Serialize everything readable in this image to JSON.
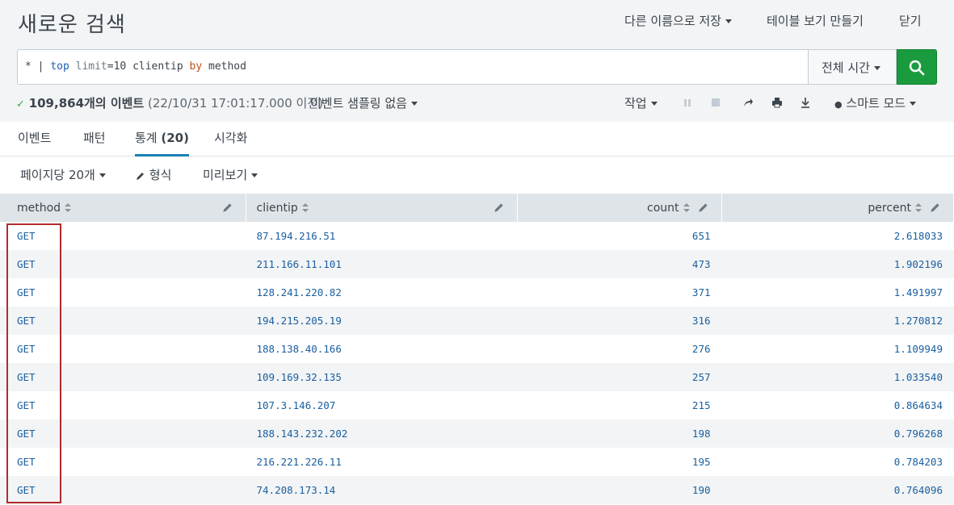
{
  "header": {
    "title": "새로운 검색",
    "save_as": "다른 이름으로 저장",
    "make_table": "테이블 보기 만들기",
    "close": "닫기"
  },
  "search": {
    "query_star": "*",
    "query_pipe": "|",
    "query_cmd": "top",
    "query_arg": "limit",
    "query_eq": "=10 clientip",
    "query_by": "by",
    "query_field": "method",
    "time_range": "전체 시간"
  },
  "status": {
    "count": "109,864개의 이벤트",
    "time": "(22/10/31 17:01:17.000 이전)",
    "sampling": "이벤트 샘플링 없음",
    "job": "작업",
    "mode": "스마트 모드"
  },
  "tabs": [
    {
      "label": "이벤트"
    },
    {
      "label": "패턴"
    },
    {
      "label": "통계",
      "count": "(20)"
    },
    {
      "label": "시각화"
    }
  ],
  "options": {
    "per_page": "페이지당 20개",
    "format": "형식",
    "preview": "미리보기"
  },
  "table": {
    "columns": [
      "method",
      "clientip",
      "count",
      "percent"
    ],
    "rows": [
      {
        "method": "GET",
        "clientip": "87.194.216.51",
        "count": "651",
        "percent": "2.618033"
      },
      {
        "method": "GET",
        "clientip": "211.166.11.101",
        "count": "473",
        "percent": "1.902196"
      },
      {
        "method": "GET",
        "clientip": "128.241.220.82",
        "count": "371",
        "percent": "1.491997"
      },
      {
        "method": "GET",
        "clientip": "194.215.205.19",
        "count": "316",
        "percent": "1.270812"
      },
      {
        "method": "GET",
        "clientip": "188.138.40.166",
        "count": "276",
        "percent": "1.109949"
      },
      {
        "method": "GET",
        "clientip": "109.169.32.135",
        "count": "257",
        "percent": "1.033540"
      },
      {
        "method": "GET",
        "clientip": "107.3.146.207",
        "count": "215",
        "percent": "0.864634"
      },
      {
        "method": "GET",
        "clientip": "188.143.232.202",
        "count": "198",
        "percent": "0.796268"
      },
      {
        "method": "GET",
        "clientip": "216.221.226.11",
        "count": "195",
        "percent": "0.784203"
      },
      {
        "method": "GET",
        "clientip": "74.208.173.14",
        "count": "190",
        "percent": "0.764096"
      }
    ]
  },
  "colors": {
    "accent": "#1a9c3e",
    "tab_underline": "#1a80b6",
    "highlight_box": "#b22b2b"
  }
}
